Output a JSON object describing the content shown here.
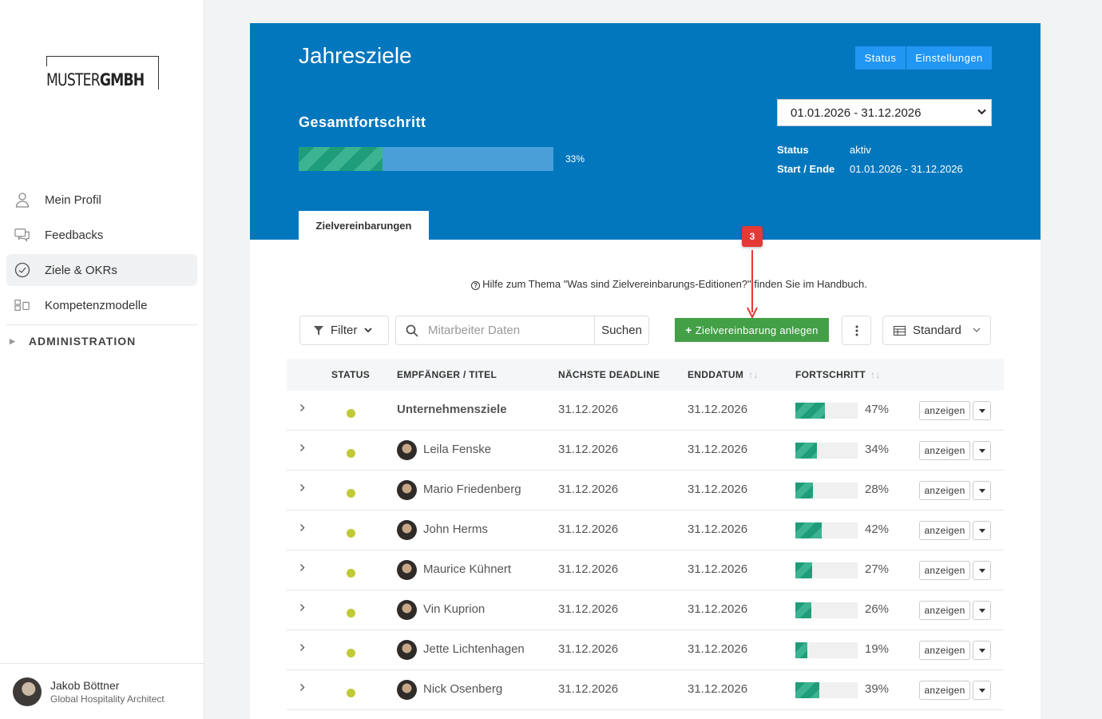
{
  "sidebar": {
    "logo": {
      "light": "MUSTER",
      "bold": "GMBH"
    },
    "items": [
      {
        "label": "Mein Profil",
        "icon": "user-icon"
      },
      {
        "label": "Feedbacks",
        "icon": "chat-icon"
      },
      {
        "label": "Ziele & OKRs",
        "icon": "check-circle-icon",
        "active": true
      },
      {
        "label": "Kompetenzmodelle",
        "icon": "grid-icon"
      }
    ],
    "admin_label": "ADMINISTRATION",
    "user": {
      "name": "Jakob Böttner",
      "role": "Global Hospitality Architect"
    }
  },
  "header": {
    "title": "Jahresziele",
    "status_button": "Status",
    "settings_button": "Einstellungen",
    "progress_label": "Gesamtfortschritt",
    "progress_value": 33,
    "progress_text": "33%",
    "period_selected": "01.01.2026 - 31.12.2026",
    "meta": {
      "status_key": "Status",
      "status_value": "aktiv",
      "range_key": "Start / Ende",
      "range_value": "01.01.2026 - 31.12.2026"
    },
    "tab": "Zielvereinbarungen"
  },
  "help_text": "Hilfe zum Thema \"Was sind Zielvereinbarungs-Editionen?\" finden Sie im Handbuch.",
  "toolbar": {
    "filter_label": "Filter",
    "search_placeholder": "Mitarbeiter Daten",
    "search_button": "Suchen",
    "add_button": "Zielvereinbarung anlegen",
    "view_label": "Standard"
  },
  "annotation_badge": "3",
  "colors": {
    "header_bg": "#0277bd",
    "add_button": "#43a047",
    "status_dot": "#c0ca33",
    "badge": "#e53935"
  },
  "table": {
    "headers": {
      "status": "STATUS",
      "recipient": "EMPFÄNGER / TITEL",
      "deadline": "NÄCHSTE DEADLINE",
      "end": "ENDDATUM",
      "progress": "FORTSCHRITT"
    },
    "show_label": "anzeigen",
    "rows": [
      {
        "name": "Unternehmensziele",
        "deadline": "31.12.2026",
        "end": "31.12.2026",
        "progress": 47,
        "progress_text": "47%",
        "bold": true
      },
      {
        "name": "Leila Fenske",
        "deadline": "31.12.2026",
        "end": "31.12.2026",
        "progress": 34,
        "progress_text": "34%"
      },
      {
        "name": "Mario Friedenberg",
        "deadline": "31.12.2026",
        "end": "31.12.2026",
        "progress": 28,
        "progress_text": "28%"
      },
      {
        "name": "John Herms",
        "deadline": "31.12.2026",
        "end": "31.12.2026",
        "progress": 42,
        "progress_text": "42%"
      },
      {
        "name": "Maurice Kühnert",
        "deadline": "31.12.2026",
        "end": "31.12.2026",
        "progress": 27,
        "progress_text": "27%"
      },
      {
        "name": "Vin Kuprion",
        "deadline": "31.12.2026",
        "end": "31.12.2026",
        "progress": 26,
        "progress_text": "26%"
      },
      {
        "name": "Jette Lichtenhagen",
        "deadline": "31.12.2026",
        "end": "31.12.2026",
        "progress": 19,
        "progress_text": "19%"
      },
      {
        "name": "Nick Osenberg",
        "deadline": "31.12.2026",
        "end": "31.12.2026",
        "progress": 39,
        "progress_text": "39%"
      }
    ]
  }
}
